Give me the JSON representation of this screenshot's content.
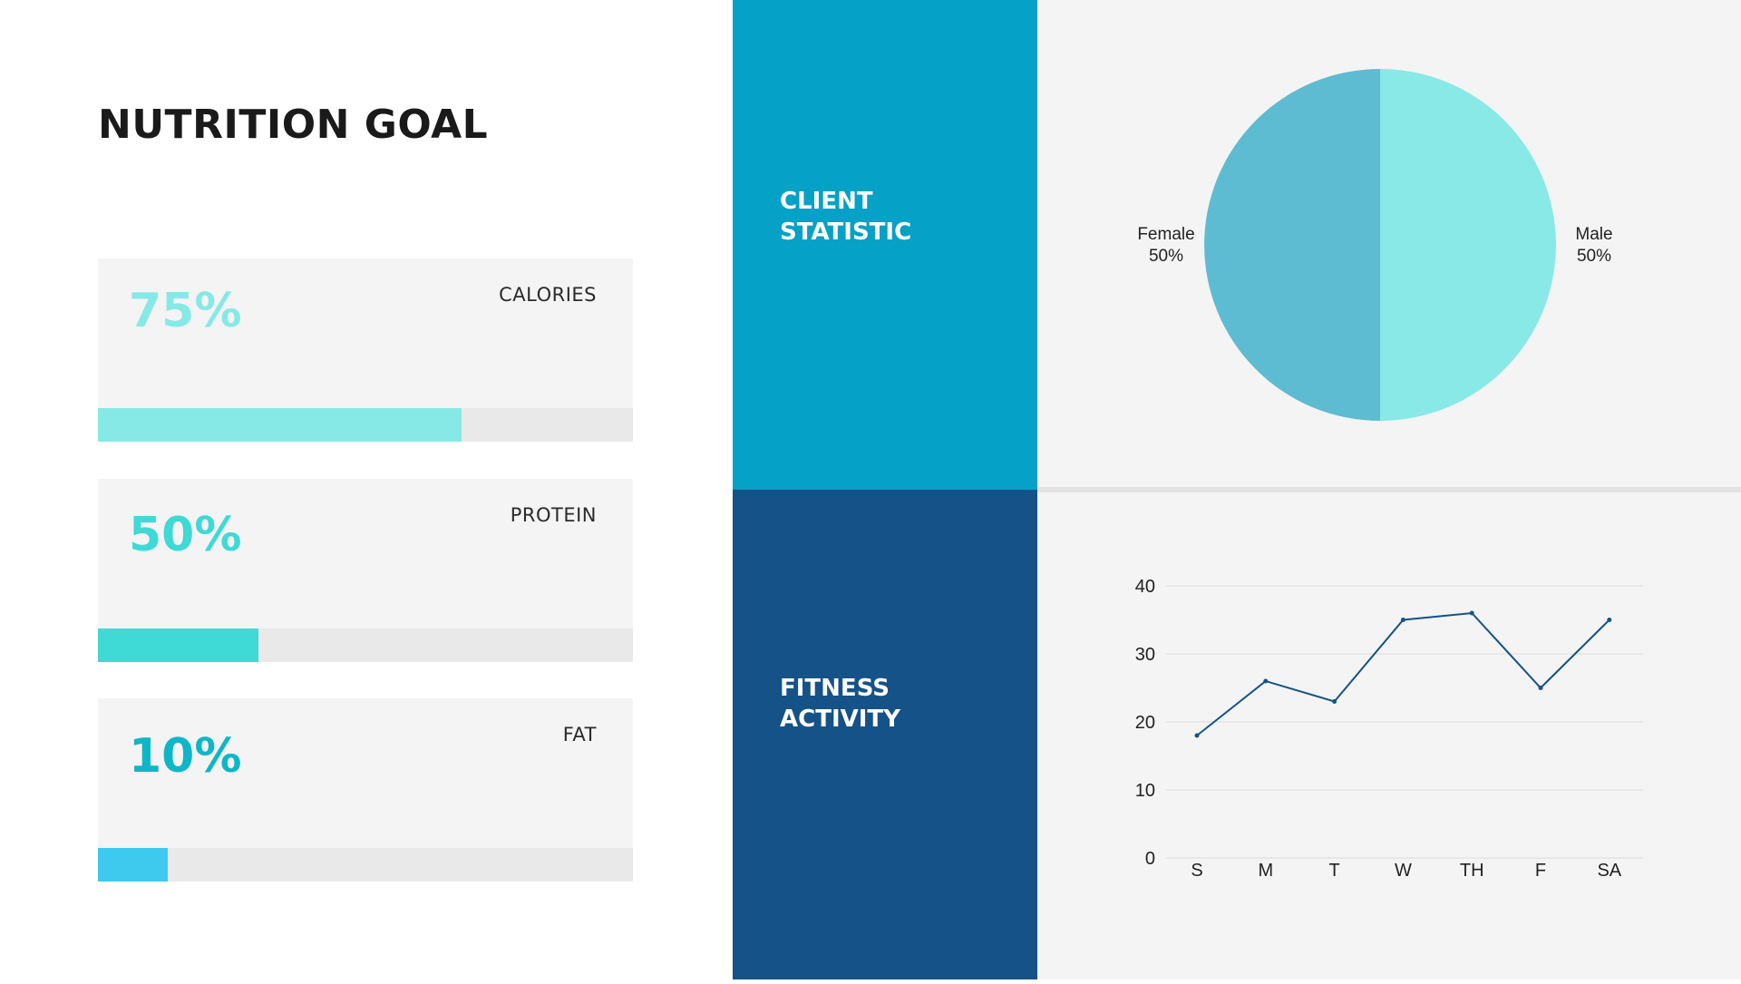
{
  "nutrition": {
    "title": "NUTRITION GOAL",
    "goals": [
      {
        "label": "CALORIES",
        "percent_text": "75%",
        "bar_fill": 0.68,
        "color": "#86e9e6"
      },
      {
        "label": "PROTEIN",
        "percent_text": "50%",
        "bar_fill": 0.3,
        "color": "#3fd9d6"
      },
      {
        "label": "FAT",
        "percent_text": "10%",
        "bar_fill": 0.13,
        "color": "#0db7c7"
      }
    ],
    "fat_bar_color": "#3ec9ee"
  },
  "panels": {
    "client_statistic": {
      "title": "CLIENT\nSTATISTIC",
      "color": "#05a1c6"
    },
    "fitness_activity": {
      "title": "FITNESS\nACTIVITY",
      "color": "#155287"
    }
  },
  "chart_data": [
    {
      "type": "pie",
      "labels": [
        "Male",
        "Female"
      ],
      "values": [
        50,
        50
      ],
      "value_labels": [
        "50%",
        "50%"
      ],
      "colors": [
        "#88e9e6",
        "#5dbcd2"
      ]
    },
    {
      "type": "line",
      "categories": [
        "S",
        "M",
        "T",
        "W",
        "TH",
        "F",
        "SA"
      ],
      "series": [
        {
          "values": [
            18,
            26,
            23,
            35,
            36,
            25,
            35
          ],
          "color": "#155287"
        }
      ],
      "ylim": [
        0,
        40
      ],
      "yticks": [
        0,
        10,
        20,
        30,
        40
      ],
      "grid": true
    }
  ]
}
